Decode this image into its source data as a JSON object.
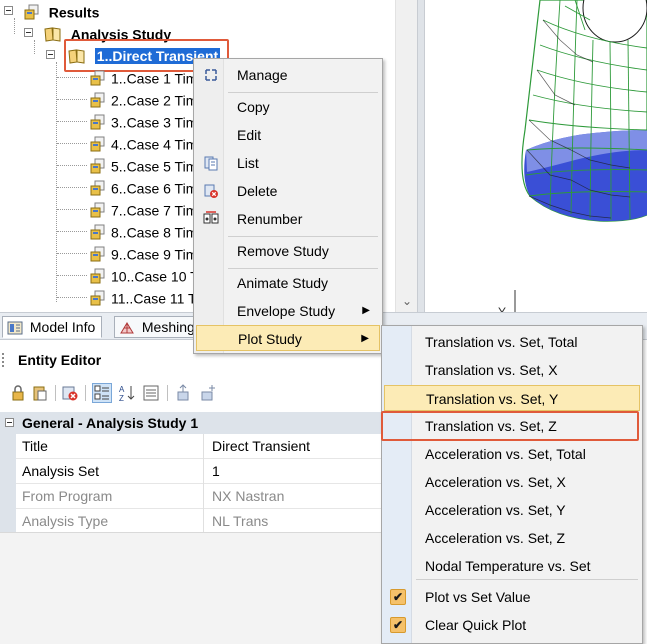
{
  "tree": {
    "root_label": "Results",
    "study_label": "Analysis Study",
    "selected_label": "1..Direct Transient",
    "cases": [
      "1..Case 1 Tim",
      "2..Case 2 Tim",
      "3..Case 3 Tim",
      "4..Case 4 Tim",
      "5..Case 5 Tim",
      "6..Case 6 Tim",
      "7..Case 7 Tim",
      "8..Case 8 Tim",
      "9..Case 9 Tim",
      "10..Case 10 T",
      "11..Case 11 T"
    ],
    "scroll_down_glyph": "⌄"
  },
  "tabs": {
    "model_info": "Model Info",
    "meshing": "Meshing"
  },
  "entity_editor": {
    "title": "Entity Editor",
    "group": "General - Analysis Study 1",
    "rows": [
      {
        "name": "Title",
        "value": "Direct Transient",
        "dim": false
      },
      {
        "name": "Analysis Set",
        "value": "1",
        "dim": false
      },
      {
        "name": "From Program",
        "value": "NX Nastran",
        "dim": true
      },
      {
        "name": "Analysis Type",
        "value": "NL Trans",
        "dim": true
      }
    ]
  },
  "context_menu": {
    "manage": "Manage",
    "copy": "Copy",
    "edit": "Edit",
    "list": "List",
    "delete": "Delete",
    "renumber": "Renumber",
    "remove_study": "Remove Study",
    "animate_study": "Animate Study",
    "envelope_study": "Envelope Study",
    "plot_study": "Plot Study",
    "submenu_arrow": "▶"
  },
  "plot_submenu": {
    "items": [
      "Translation vs. Set, Total",
      "Translation vs. Set, X",
      "Translation vs. Set, Y",
      "Translation vs. Set, Z",
      "Acceleration vs. Set, Total",
      "Acceleration vs. Set, X",
      "Acceleration vs. Set, Y",
      "Acceleration vs. Set, Z",
      "Nodal Temperature vs. Set"
    ],
    "hovered_index": 2,
    "highlighted_index": 3,
    "plot_vs_set_value": "Plot vs Set Value",
    "clear_quick_plot": "Clear Quick Plot",
    "check_glyph": "✔"
  },
  "view_3d": {
    "axis_label": "Y"
  },
  "colors": {
    "selection_blue": "#1e6bd6",
    "highlight_red": "#e05a3a",
    "hover_yellow": "#fcebb6",
    "mesh_green": "#2e9a3a",
    "mesh_blue": "#3a4fd6"
  }
}
